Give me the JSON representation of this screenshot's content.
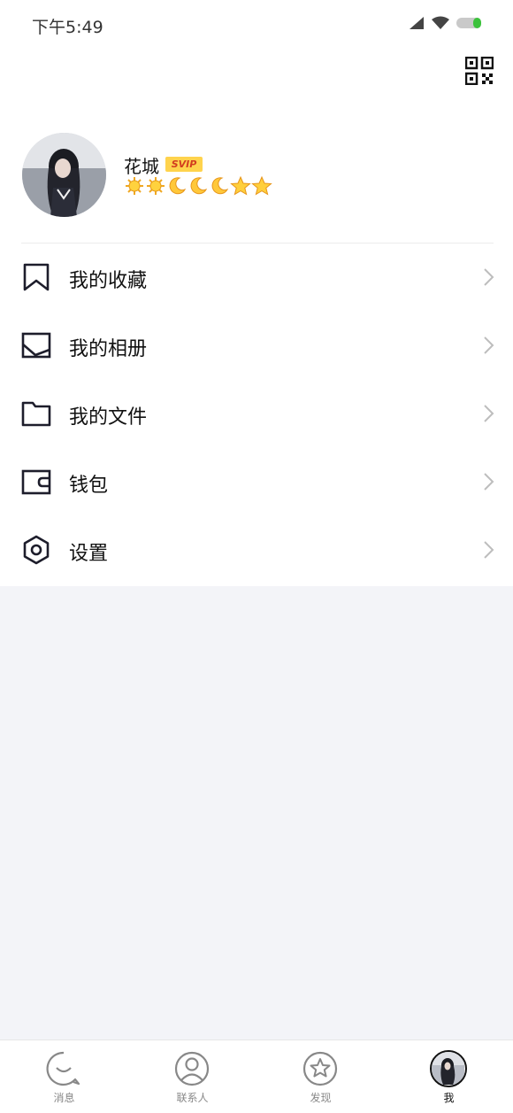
{
  "status_bar": {
    "time": "下午5:49"
  },
  "profile": {
    "name": "花城",
    "badge": "SVIP"
  },
  "menu": [
    {
      "label": "我的收藏",
      "icon": "bookmark-icon"
    },
    {
      "label": "我的相册",
      "icon": "photo-album-icon"
    },
    {
      "label": "我的文件",
      "icon": "folder-icon"
    },
    {
      "label": "钱包",
      "icon": "wallet-icon"
    },
    {
      "label": "设置",
      "icon": "settings-hexagon-icon"
    }
  ],
  "tabs": [
    {
      "label": "消息",
      "icon": "chat-bubble-icon",
      "active": false
    },
    {
      "label": "联系人",
      "icon": "contact-person-icon",
      "active": false
    },
    {
      "label": "发现",
      "icon": "star-discover-icon",
      "active": false
    },
    {
      "label": "我",
      "icon": "profile-avatar-icon",
      "active": true
    }
  ],
  "colors": {
    "accent": "#111111",
    "background": "#f3f4f8",
    "vip_badge": "#ffd34d",
    "battery": "#3cc23c"
  }
}
